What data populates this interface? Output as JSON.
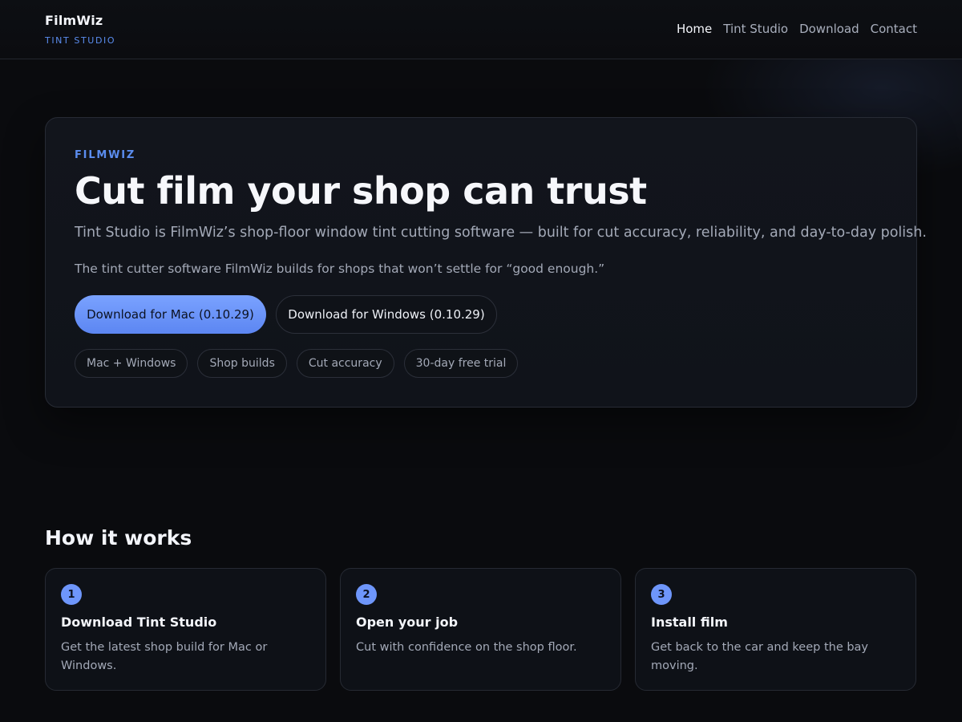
{
  "header": {
    "brand_name": "FilmWiz",
    "brand_sub": "TINT STUDIO",
    "nav": [
      {
        "label": "Home",
        "active": true
      },
      {
        "label": "Tint Studio",
        "active": false
      },
      {
        "label": "Download",
        "active": false
      },
      {
        "label": "Contact",
        "active": false
      }
    ]
  },
  "hero": {
    "eyebrow": "FILMWIZ",
    "title": "Cut film your shop can trust",
    "lead": "Tint Studio is FilmWiz’s shop-floor window tint cutting software — built for cut accuracy, reliability, and day-to-day polish.",
    "description": "The tint cutter software FilmWiz builds for shops that won’t settle for “good enough.”",
    "buttons": {
      "mac": "Download for Mac (0.10.29)",
      "windows": "Download for Windows (0.10.29)"
    },
    "chips": [
      "Mac + Windows",
      "Shop builds",
      "Cut accuracy",
      "30-day free trial"
    ]
  },
  "how_it_works": {
    "title": "How it works",
    "steps": [
      {
        "number": "1",
        "title": "Download Tint Studio",
        "text": "Get the latest shop build for Mac or Windows."
      },
      {
        "number": "2",
        "title": "Open your job",
        "text": "Cut with confidence on the shop floor."
      },
      {
        "number": "3",
        "title": "Install film",
        "text": "Get back to the car and keep the bay moving."
      }
    ]
  },
  "colors": {
    "accent": "#5b8def",
    "background": "#0a0b0e",
    "card": "#12151c",
    "primary_button": "#6e96fb"
  }
}
